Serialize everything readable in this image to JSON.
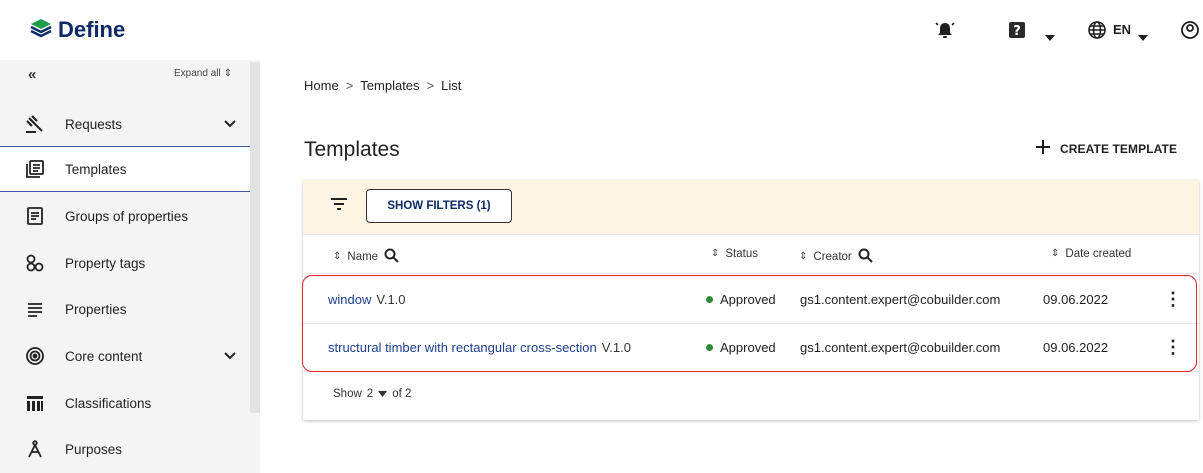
{
  "app": {
    "name": "Define",
    "language": "EN"
  },
  "sidebar": {
    "collapse_label": "«",
    "expand_all": "Expand all",
    "items": [
      {
        "label": "Requests",
        "icon": "gavel-icon",
        "expandable": true
      },
      {
        "label": "Templates",
        "icon": "template-icon",
        "active": true
      },
      {
        "label": "Groups of properties",
        "icon": "list-box-icon"
      },
      {
        "label": "Property tags",
        "icon": "tags-icon"
      },
      {
        "label": "Properties",
        "icon": "lines-icon"
      },
      {
        "label": "Core content",
        "icon": "target-icon",
        "expandable": true
      },
      {
        "label": "Classifications",
        "icon": "classification-icon"
      },
      {
        "label": "Purposes",
        "icon": "compass-icon"
      }
    ]
  },
  "breadcrumb": {
    "items": [
      "Home",
      "Templates",
      "List"
    ],
    "separator": ">"
  },
  "page": {
    "title": "Templates",
    "create_label": "CREATE TEMPLATE"
  },
  "filters": {
    "button_label": "SHOW FILTERS (1)"
  },
  "table": {
    "columns": [
      "Name",
      "Status",
      "Creator",
      "Date created"
    ],
    "rows": [
      {
        "name": "window",
        "version": "V.1.0",
        "status": "Approved",
        "creator": "gs1.content.expert@cobuilder.com",
        "date": "09.06.2022"
      },
      {
        "name": "structural timber with rectangular cross-section",
        "version": "V.1.0",
        "status": "Approved",
        "creator": "gs1.content.expert@cobuilder.com",
        "date": "09.06.2022"
      }
    ]
  },
  "pagination": {
    "show_label": "Show",
    "page_size": "2",
    "of_label": "of 2"
  },
  "colors": {
    "brand": "#0d2a66",
    "accent_green": "#2e8b3a",
    "highlight_red": "#e0242b",
    "filter_bg": "#fdf4e4"
  }
}
